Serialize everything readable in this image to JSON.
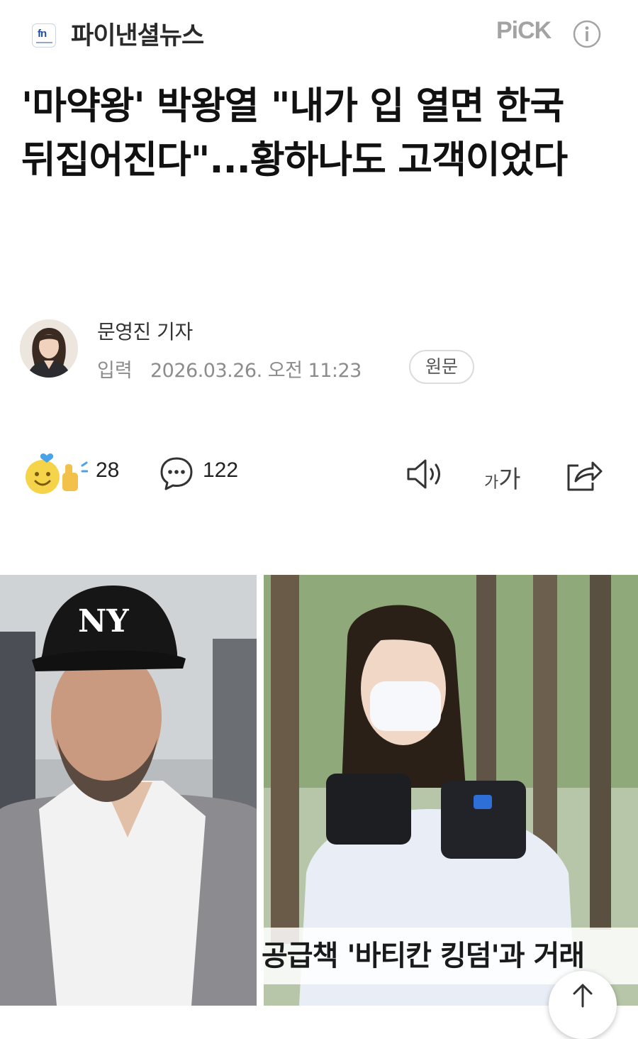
{
  "header": {
    "press_logo": "fn",
    "press_name": "파이낸셜뉴스",
    "pick_label": "PiCK",
    "info_icon": "info-icon"
  },
  "article": {
    "headline": "'마약왕' 박왕열 \"내가 입 열면 한국 뒤집어진다\"...황하나도 고객이었다",
    "reporter": "문영진 기자",
    "input_label": "입력",
    "input_datetime": "2026.03.26. 오전 11:23",
    "original_button": "원문"
  },
  "actions": {
    "reaction_count": "28",
    "comment_count": "122",
    "font_size_small": "가",
    "font_size_large": "가",
    "icons": [
      "reaction-emoji-icon",
      "comment-icon",
      "speaker-icon",
      "share-icon"
    ]
  },
  "photo": {
    "caption": "공급책 '바티칸 킹덤'과 거래"
  },
  "colors": {
    "press_blue": "#1f4fa8",
    "muted_text": "#8c8c8c",
    "pick_gray": "#a3a3a3"
  }
}
